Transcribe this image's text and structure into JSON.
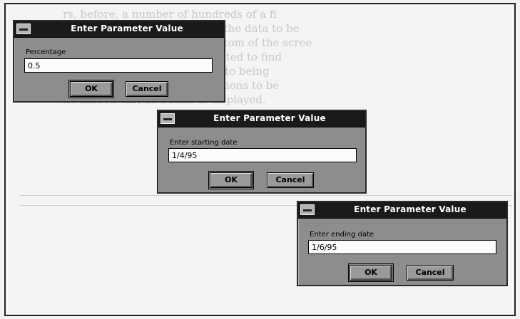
{
  "background": {
    "lines": [
      "rs, before, a number of hundreds of a fi",
      "ompleted form. The layout of the data to be",
      "ch a query is based at the bottom of the scree",
      "",
      "For example, suppose we wanted to find",
      "n employees who, in addition to being",
      "ppear in every report. The actions to be",
      "he hidden tab, as a form is displayed."
    ]
  },
  "dialogs": [
    {
      "title": "Enter Parameter Value",
      "label": "Percentage",
      "value": "0.5",
      "ok_label": "OK",
      "cancel_label": "Cancel"
    },
    {
      "title": "Enter Parameter Value",
      "label": "Enter starting date",
      "value": "1/4/95",
      "ok_label": "OK",
      "cancel_label": "Cancel"
    },
    {
      "title": "Enter Parameter Value",
      "label": "Enter ending date",
      "value": "1/6/95",
      "ok_label": "OK",
      "cancel_label": "Cancel"
    }
  ]
}
